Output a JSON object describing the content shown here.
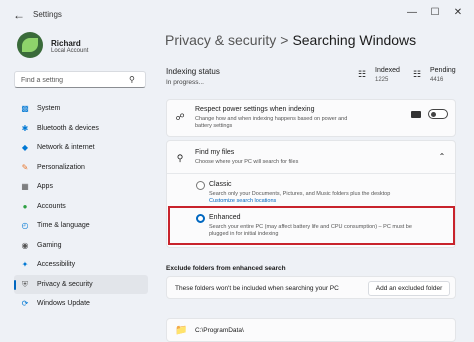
{
  "window": {
    "title": "Settings",
    "controls": [
      "minimize",
      "maximize",
      "close"
    ]
  },
  "profile": {
    "name": "Richard",
    "account": "Local Account"
  },
  "search": {
    "placeholder": "Find a setting"
  },
  "nav": {
    "items": [
      {
        "label": "System",
        "icon": "monitor-icon"
      },
      {
        "label": "Bluetooth & devices",
        "icon": "bluetooth-icon"
      },
      {
        "label": "Network & internet",
        "icon": "wifi-icon"
      },
      {
        "label": "Personalization",
        "icon": "brush-icon"
      },
      {
        "label": "Apps",
        "icon": "apps-icon"
      },
      {
        "label": "Accounts",
        "icon": "person-icon"
      },
      {
        "label": "Time & language",
        "icon": "globe-clock-icon"
      },
      {
        "label": "Gaming",
        "icon": "controller-icon"
      },
      {
        "label": "Accessibility",
        "icon": "accessibility-icon"
      },
      {
        "label": "Privacy & security",
        "icon": "shield-icon",
        "active": true
      },
      {
        "label": "Windows Update",
        "icon": "update-icon"
      }
    ]
  },
  "breadcrumb": {
    "parent": "Privacy & security",
    "separator": ">",
    "current": "Searching Windows"
  },
  "indexing": {
    "title": "Indexing status",
    "progress": "In progress...",
    "indexed_label": "Indexed",
    "indexed_value": "1225",
    "pending_label": "Pending",
    "pending_value": "4416"
  },
  "power": {
    "title": "Respect power settings when indexing",
    "desc_line1": "Change how and when indexing happens based on power and",
    "desc_line2": "battery settings",
    "toggle_on": false
  },
  "findfiles": {
    "title": "Find my files",
    "desc": "Choose where your PC will search for files",
    "classic_label": "Classic",
    "classic_desc": "Search only your Documents, Pictures, and Music folders plus the desktop",
    "classic_link": "Customize search locations",
    "enhanced_label": "Enhanced",
    "enhanced_desc_line1": "Search your entire PC (may affect battery life and CPU consumption) – PC must be",
    "enhanced_desc_line2": "plugged in for initial indexing",
    "selected": "Enhanced"
  },
  "exclude": {
    "heading": "Exclude folders from enhanced search",
    "info": "These folders won't be included when searching your PC",
    "add_button": "Add an excluded folder",
    "folders": [
      "C:\\ProgramData\\"
    ]
  },
  "colors": {
    "accent": "#0067c0",
    "highlight_box": "#c8232c"
  }
}
